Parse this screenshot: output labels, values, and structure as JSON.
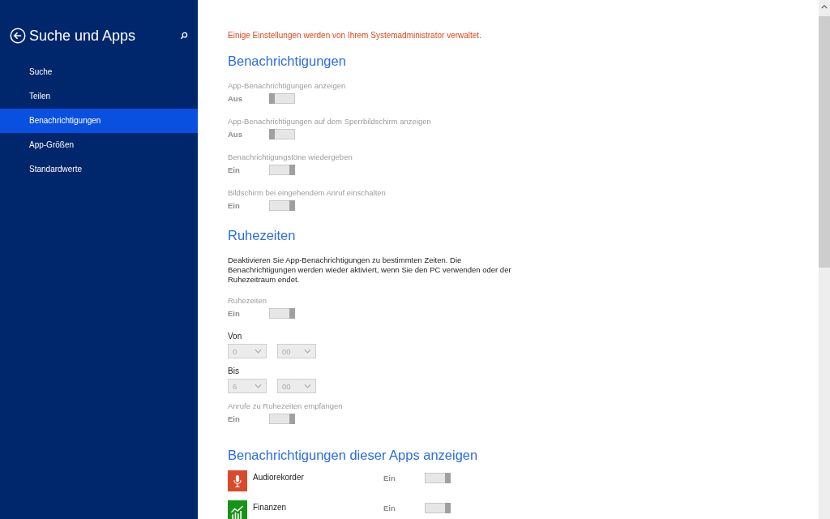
{
  "sidebar": {
    "title": "Suche und Apps",
    "items": [
      {
        "label": "Suche",
        "selected": false
      },
      {
        "label": "Teilen",
        "selected": false
      },
      {
        "label": "Benachrichtigungen",
        "selected": true
      },
      {
        "label": "App-Größen",
        "selected": false
      },
      {
        "label": "Standardwerte",
        "selected": false
      }
    ]
  },
  "admin_notice": "Einige Einstellungen werden von Ihrem Systemadministrator verwaltet.",
  "notifications": {
    "heading": "Benachrichtigungen",
    "toggles": [
      {
        "label": "App-Benachrichtigungen anzeigen",
        "state_text": "Aus",
        "on": false,
        "disabled": true
      },
      {
        "label": "App-Benachrichtigungen auf dem Sperrbildschirm anzeigen",
        "state_text": "Aus",
        "on": false,
        "disabled": true
      },
      {
        "label": "Benachrichtigungstöne wiedergeben",
        "state_text": "Ein",
        "on": true,
        "disabled": true
      },
      {
        "label": "Bildschirm bei eingehendem Anruf einschalten",
        "state_text": "Ein",
        "on": true,
        "disabled": true
      }
    ]
  },
  "quiet_hours": {
    "heading": "Ruhezeiten",
    "description": "Deaktivieren Sie App-Benachrichtigungen zu bestimmten Zeiten. Die Benachrichtigungen werden wieder aktiviert, wenn Sie den PC verwenden oder der Ruhezeitraum endet.",
    "toggle": {
      "label": "Ruhezeiten",
      "state_text": "Ein",
      "on": true,
      "disabled": true
    },
    "times": [
      {
        "label": "Von",
        "hour": "0",
        "minute": "00",
        "disabled": true
      },
      {
        "label": "Bis",
        "hour": "6",
        "minute": "00",
        "disabled": true
      }
    ],
    "calls_toggle": {
      "label": "Anrufe zu Ruhezeiten empfangen",
      "state_text": "Ein",
      "on": true,
      "disabled": true
    }
  },
  "apps": {
    "heading": "Benachrichtigungen dieser Apps anzeigen",
    "items": [
      {
        "name": "Audiorekorder",
        "kind": "microphone",
        "color": "#d84a2b",
        "state_text": "Ein",
        "on": true,
        "disabled": true
      },
      {
        "name": "Finanzen",
        "kind": "chart",
        "color": "#159418",
        "state_text": "Ein",
        "on": true,
        "disabled": true
      }
    ]
  }
}
